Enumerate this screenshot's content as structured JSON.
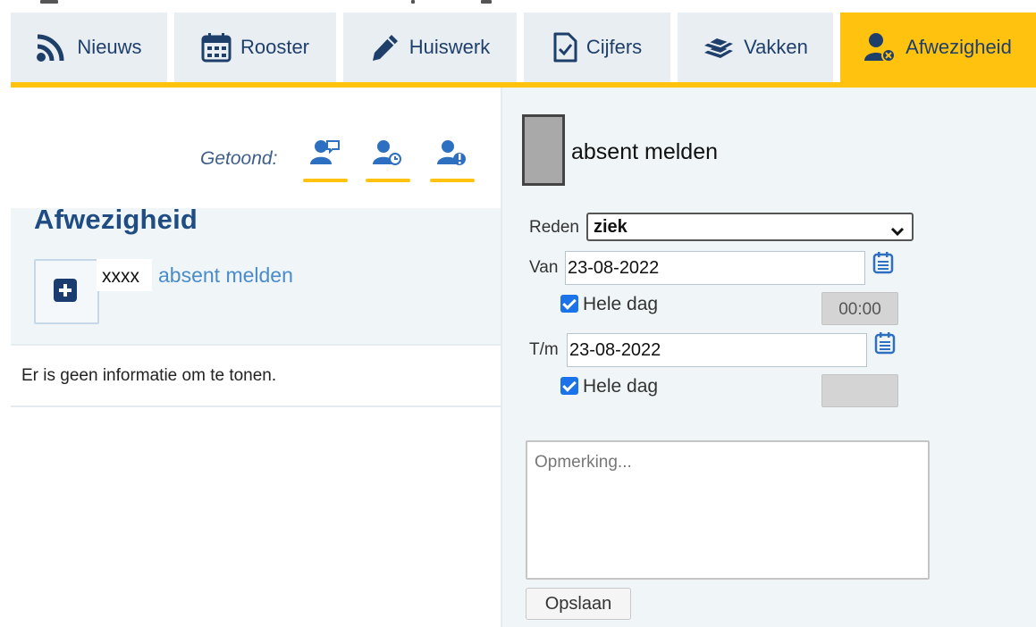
{
  "tabs": [
    {
      "label": "Nieuws",
      "icon": "rss-icon",
      "active": false
    },
    {
      "label": "Rooster",
      "icon": "calendar-icon",
      "active": false
    },
    {
      "label": "Huiswerk",
      "icon": "pencil-icon",
      "active": false
    },
    {
      "label": "Cijfers",
      "icon": "document-check-icon",
      "active": false
    },
    {
      "label": "Vakken",
      "icon": "books-icon",
      "active": false
    },
    {
      "label": "Afwezigheid",
      "icon": "user-absent-icon",
      "active": true
    }
  ],
  "left": {
    "shown_label": "Getoond:",
    "filters": [
      {
        "icon": "user-comment-icon"
      },
      {
        "icon": "user-clock-icon"
      },
      {
        "icon": "user-info-icon"
      }
    ],
    "heading": "Afwezigheid",
    "student_name": "xxxx",
    "add_link": "absent melden",
    "empty_text": "Er is geen informatie om te tonen."
  },
  "form": {
    "title": "absent melden",
    "reason_label": "Reden",
    "reason_value": "ziek",
    "from_label": "Van",
    "from_date": "23-08-2022",
    "from_whole_day": "Hele dag",
    "from_time": "00:00",
    "to_label": "T/m",
    "to_date": "23-08-2022",
    "to_whole_day": "Hele dag",
    "to_time": "",
    "remark_placeholder": "Opmerking...",
    "save_label": "Opslaan"
  },
  "colors": {
    "accent": "#ffc20e",
    "primary": "#1f3f6b",
    "link": "#4a8cc9",
    "checkbox": "#1a73e8"
  }
}
